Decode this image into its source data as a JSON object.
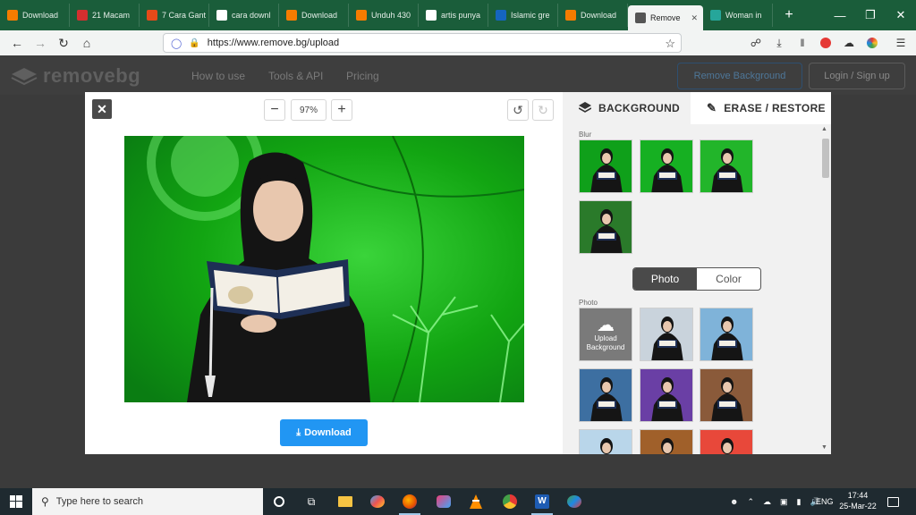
{
  "browser": {
    "tabs": [
      {
        "label": "Download",
        "favicon_color": "#f57c00"
      },
      {
        "label": "21 Macam",
        "favicon_color": "#d32f2f"
      },
      {
        "label": "7 Cara Gant",
        "favicon_color": "#e64a19"
      },
      {
        "label": "cara downl",
        "favicon_color": "#ffffff"
      },
      {
        "label": "Download",
        "favicon_color": "#f57c00"
      },
      {
        "label": "Unduh 430",
        "favicon_color": "#f57c00"
      },
      {
        "label": "artis punya",
        "favicon_color": "#ffffff"
      },
      {
        "label": "Islamic gre",
        "favicon_color": "#1565c0"
      },
      {
        "label": "Download",
        "favicon_color": "#f57c00"
      },
      {
        "label": "Remove",
        "favicon_color": "#555555",
        "active": true
      },
      {
        "label": "Woman in",
        "favicon_color": "#26a69a"
      }
    ],
    "url": "https://www.remove.bg/upload"
  },
  "site": {
    "logo_text": "removebg",
    "nav": [
      "How to use",
      "Tools & API",
      "Pricing"
    ],
    "remove_bg_button": "Remove Background",
    "login_button": "Login / Sign up"
  },
  "editor": {
    "zoom": "97%",
    "download_label": "Download",
    "tabs": {
      "background": "BACKGROUND",
      "erase": "ERASE / RESTORE"
    },
    "blur_label": "Blur",
    "photo_label": "Photo",
    "toggle": {
      "photo": "Photo",
      "color": "Color"
    },
    "upload_line1": "Upload",
    "upload_line2": "Background",
    "accent_color": "#2196f3"
  },
  "taskbar": {
    "search_placeholder": "Type here to search",
    "language": "ENG",
    "time": "17:44",
    "date": "25-Mar-22"
  }
}
